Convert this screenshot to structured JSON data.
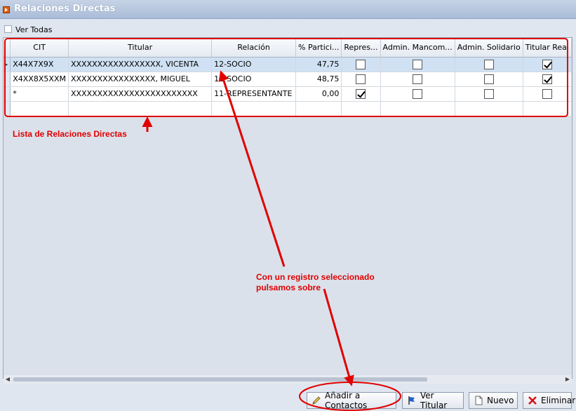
{
  "window": {
    "title": "Relaciones Directas",
    "icon": "play-icon"
  },
  "filter": {
    "ver_todas_label": "Ver Todas",
    "ver_todas_checked": false
  },
  "grid": {
    "columns": [
      "CIT",
      "Titular",
      "Relación",
      "% Partici...",
      "Repres...",
      "Admin. Mancom...",
      "Admin. Solidario",
      "Titular Real"
    ],
    "rows": [
      {
        "indicator": "▸",
        "cit": "X44X7X9X",
        "titular": "XXXXXXXXXXXXXXXXX, VICENTA",
        "relacion": "12-SOCIO",
        "participacion": "47,75",
        "repres": false,
        "admin_mancom": false,
        "admin_solidario": false,
        "titular_real": true,
        "selected": true
      },
      {
        "indicator": "",
        "cit": "X4XX8X5XXM",
        "titular": "XXXXXXXXXXXXXXXX, MIGUEL",
        "relacion": "12-SOCIO",
        "participacion": "48,75",
        "repres": false,
        "admin_mancom": false,
        "admin_solidario": false,
        "titular_real": true,
        "selected": false
      },
      {
        "indicator": "",
        "cit": "*",
        "titular": "XXXXXXXXXXXXXXXXXXXXXXXX",
        "relacion": "11-REPRESENTANTE",
        "participacion": "0,00",
        "repres": true,
        "admin_mancom": false,
        "admin_solidario": false,
        "titular_real": false,
        "selected": false
      }
    ]
  },
  "annotations": {
    "lista": "Lista de Relaciones Directas",
    "instruccion_1": "Con un registro seleccionado",
    "instruccion_2": "pulsamos sobre",
    "color": "#e00000"
  },
  "buttons": {
    "anadir": {
      "label": "Añadir a Contactos",
      "icon": "pencil-icon"
    },
    "ver_titular": {
      "label": "Ver Titular",
      "icon": "flag-icon"
    },
    "nuevo": {
      "label": "Nuevo",
      "icon": "document-icon"
    },
    "eliminar": {
      "label": "Eliminar",
      "icon": "red-x-icon"
    }
  }
}
